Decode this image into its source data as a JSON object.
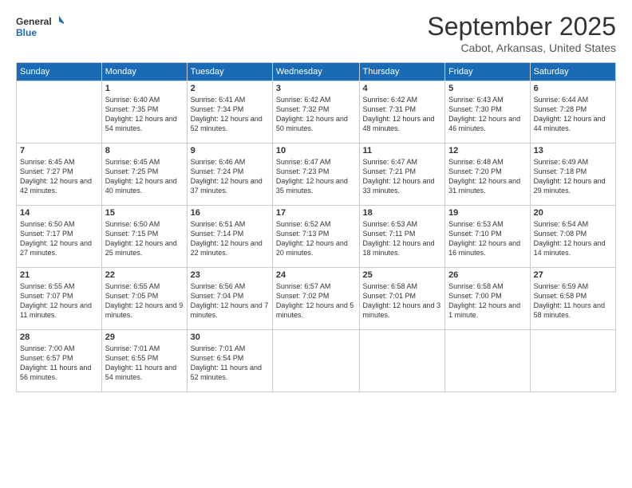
{
  "header": {
    "logo_line1": "General",
    "logo_line2": "Blue",
    "month": "September 2025",
    "location": "Cabot, Arkansas, United States"
  },
  "days_of_week": [
    "Sunday",
    "Monday",
    "Tuesday",
    "Wednesday",
    "Thursday",
    "Friday",
    "Saturday"
  ],
  "weeks": [
    [
      {
        "day": "",
        "sunrise": "",
        "sunset": "",
        "daylight": ""
      },
      {
        "day": "1",
        "sunrise": "Sunrise: 6:40 AM",
        "sunset": "Sunset: 7:35 PM",
        "daylight": "Daylight: 12 hours and 54 minutes."
      },
      {
        "day": "2",
        "sunrise": "Sunrise: 6:41 AM",
        "sunset": "Sunset: 7:34 PM",
        "daylight": "Daylight: 12 hours and 52 minutes."
      },
      {
        "day": "3",
        "sunrise": "Sunrise: 6:42 AM",
        "sunset": "Sunset: 7:32 PM",
        "daylight": "Daylight: 12 hours and 50 minutes."
      },
      {
        "day": "4",
        "sunrise": "Sunrise: 6:42 AM",
        "sunset": "Sunset: 7:31 PM",
        "daylight": "Daylight: 12 hours and 48 minutes."
      },
      {
        "day": "5",
        "sunrise": "Sunrise: 6:43 AM",
        "sunset": "Sunset: 7:30 PM",
        "daylight": "Daylight: 12 hours and 46 minutes."
      },
      {
        "day": "6",
        "sunrise": "Sunrise: 6:44 AM",
        "sunset": "Sunset: 7:28 PM",
        "daylight": "Daylight: 12 hours and 44 minutes."
      }
    ],
    [
      {
        "day": "7",
        "sunrise": "Sunrise: 6:45 AM",
        "sunset": "Sunset: 7:27 PM",
        "daylight": "Daylight: 12 hours and 42 minutes."
      },
      {
        "day": "8",
        "sunrise": "Sunrise: 6:45 AM",
        "sunset": "Sunset: 7:25 PM",
        "daylight": "Daylight: 12 hours and 40 minutes."
      },
      {
        "day": "9",
        "sunrise": "Sunrise: 6:46 AM",
        "sunset": "Sunset: 7:24 PM",
        "daylight": "Daylight: 12 hours and 37 minutes."
      },
      {
        "day": "10",
        "sunrise": "Sunrise: 6:47 AM",
        "sunset": "Sunset: 7:23 PM",
        "daylight": "Daylight: 12 hours and 35 minutes."
      },
      {
        "day": "11",
        "sunrise": "Sunrise: 6:47 AM",
        "sunset": "Sunset: 7:21 PM",
        "daylight": "Daylight: 12 hours and 33 minutes."
      },
      {
        "day": "12",
        "sunrise": "Sunrise: 6:48 AM",
        "sunset": "Sunset: 7:20 PM",
        "daylight": "Daylight: 12 hours and 31 minutes."
      },
      {
        "day": "13",
        "sunrise": "Sunrise: 6:49 AM",
        "sunset": "Sunset: 7:18 PM",
        "daylight": "Daylight: 12 hours and 29 minutes."
      }
    ],
    [
      {
        "day": "14",
        "sunrise": "Sunrise: 6:50 AM",
        "sunset": "Sunset: 7:17 PM",
        "daylight": "Daylight: 12 hours and 27 minutes."
      },
      {
        "day": "15",
        "sunrise": "Sunrise: 6:50 AM",
        "sunset": "Sunset: 7:15 PM",
        "daylight": "Daylight: 12 hours and 25 minutes."
      },
      {
        "day": "16",
        "sunrise": "Sunrise: 6:51 AM",
        "sunset": "Sunset: 7:14 PM",
        "daylight": "Daylight: 12 hours and 22 minutes."
      },
      {
        "day": "17",
        "sunrise": "Sunrise: 6:52 AM",
        "sunset": "Sunset: 7:13 PM",
        "daylight": "Daylight: 12 hours and 20 minutes."
      },
      {
        "day": "18",
        "sunrise": "Sunrise: 6:53 AM",
        "sunset": "Sunset: 7:11 PM",
        "daylight": "Daylight: 12 hours and 18 minutes."
      },
      {
        "day": "19",
        "sunrise": "Sunrise: 6:53 AM",
        "sunset": "Sunset: 7:10 PM",
        "daylight": "Daylight: 12 hours and 16 minutes."
      },
      {
        "day": "20",
        "sunrise": "Sunrise: 6:54 AM",
        "sunset": "Sunset: 7:08 PM",
        "daylight": "Daylight: 12 hours and 14 minutes."
      }
    ],
    [
      {
        "day": "21",
        "sunrise": "Sunrise: 6:55 AM",
        "sunset": "Sunset: 7:07 PM",
        "daylight": "Daylight: 12 hours and 11 minutes."
      },
      {
        "day": "22",
        "sunrise": "Sunrise: 6:55 AM",
        "sunset": "Sunset: 7:05 PM",
        "daylight": "Daylight: 12 hours and 9 minutes."
      },
      {
        "day": "23",
        "sunrise": "Sunrise: 6:56 AM",
        "sunset": "Sunset: 7:04 PM",
        "daylight": "Daylight: 12 hours and 7 minutes."
      },
      {
        "day": "24",
        "sunrise": "Sunrise: 6:57 AM",
        "sunset": "Sunset: 7:02 PM",
        "daylight": "Daylight: 12 hours and 5 minutes."
      },
      {
        "day": "25",
        "sunrise": "Sunrise: 6:58 AM",
        "sunset": "Sunset: 7:01 PM",
        "daylight": "Daylight: 12 hours and 3 minutes."
      },
      {
        "day": "26",
        "sunrise": "Sunrise: 6:58 AM",
        "sunset": "Sunset: 7:00 PM",
        "daylight": "Daylight: 12 hours and 1 minute."
      },
      {
        "day": "27",
        "sunrise": "Sunrise: 6:59 AM",
        "sunset": "Sunset: 6:58 PM",
        "daylight": "Daylight: 11 hours and 58 minutes."
      }
    ],
    [
      {
        "day": "28",
        "sunrise": "Sunrise: 7:00 AM",
        "sunset": "Sunset: 6:57 PM",
        "daylight": "Daylight: 11 hours and 56 minutes."
      },
      {
        "day": "29",
        "sunrise": "Sunrise: 7:01 AM",
        "sunset": "Sunset: 6:55 PM",
        "daylight": "Daylight: 11 hours and 54 minutes."
      },
      {
        "day": "30",
        "sunrise": "Sunrise: 7:01 AM",
        "sunset": "Sunset: 6:54 PM",
        "daylight": "Daylight: 11 hours and 52 minutes."
      },
      {
        "day": "",
        "sunrise": "",
        "sunset": "",
        "daylight": ""
      },
      {
        "day": "",
        "sunrise": "",
        "sunset": "",
        "daylight": ""
      },
      {
        "day": "",
        "sunrise": "",
        "sunset": "",
        "daylight": ""
      },
      {
        "day": "",
        "sunrise": "",
        "sunset": "",
        "daylight": ""
      }
    ]
  ]
}
